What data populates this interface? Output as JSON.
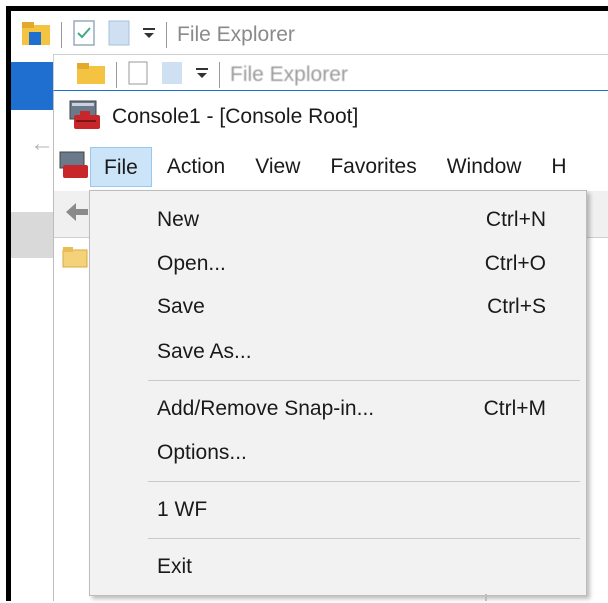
{
  "file_explorer_back": {
    "title": "File Explorer"
  },
  "file_explorer_front": {
    "title": "File Explorer"
  },
  "console": {
    "title": "Console1 - [Console Root]",
    "menus": [
      "File",
      "Action",
      "View",
      "Favorites",
      "Window",
      "H"
    ]
  },
  "file_menu": {
    "items": [
      {
        "label": "New",
        "shortcut": "Ctrl+N"
      },
      {
        "label": "Open...",
        "shortcut": "Ctrl+O"
      },
      {
        "label": "Save",
        "shortcut": "Ctrl+S"
      },
      {
        "label": "Save As...",
        "shortcut": ""
      },
      {
        "label": "Add/Remove Snap-in...",
        "shortcut": "Ctrl+M"
      },
      {
        "label": "Options...",
        "shortcut": ""
      },
      {
        "label": "1 WF",
        "shortcut": ""
      },
      {
        "label": "Exit",
        "shortcut": ""
      }
    ]
  },
  "colors": {
    "accent": "#1e6fd0",
    "menu_highlight": "#cce4f7",
    "folder": "#f4c342"
  },
  "icons": [
    "folder-icon",
    "properties-icon",
    "new-folder-icon",
    "dropdown-arrow-icon",
    "mmc-console-icon",
    "back-arrow-icon"
  ]
}
